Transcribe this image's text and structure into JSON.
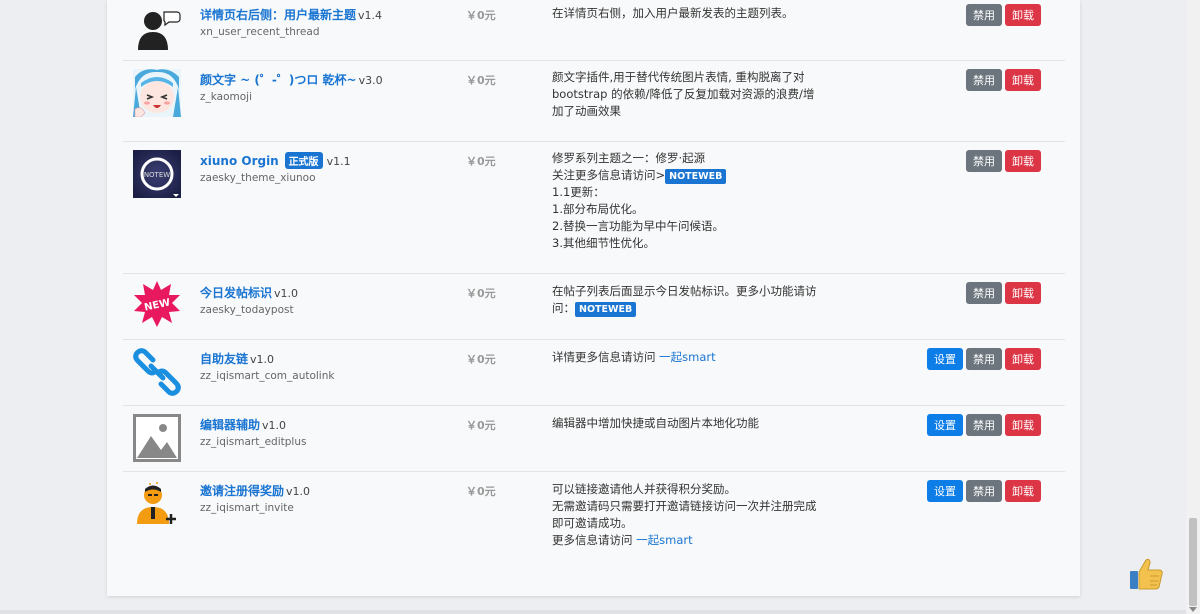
{
  "plugins": [
    {
      "name": "详情页右后侧：用户最新主题",
      "version": "v1.4",
      "id": "xn_user_recent_thread",
      "price": "￥0元",
      "desc": [
        "在详情页右侧，加入用户最新发表的主题列表。"
      ],
      "settings": false,
      "icon": "user-avatar-icon"
    },
    {
      "name": "颜文字 ~ (゜-゜)つロ 乾杯~",
      "version": "v3.0",
      "id": "z_kaomoji",
      "price": "￥0元",
      "desc": [
        "颜文字插件,用于替代传统图片表情, 重构脱离了对",
        "bootstrap 的依赖/降低了反复加载对资源的浪费/增",
        "加了动画效果"
      ],
      "settings": false,
      "icon": "anime-face-icon"
    },
    {
      "name": "xiuno Orgin",
      "badge": "正式版",
      "version": "v1.1",
      "id": "zaesky_theme_xiunoo",
      "price": "￥0元",
      "desc": [
        "修罗系列主题之一：修罗·起源",
        "关注更多信息请访问>",
        "1.1更新：",
        "1.部分布局优化。",
        "2.替换一言功能为早中午问候语。",
        "3.其他细节性优化。"
      ],
      "note": "NOTEWEB",
      "settings": false,
      "icon": "theme-ring-icon",
      "thumb_text": "NOTEW"
    },
    {
      "name": "今日发帖标识",
      "version": "v1.0",
      "id": "zaesky_todaypost",
      "price": "￥0元",
      "desc": [
        "在帖子列表后面显示今日发帖标识。更多小功能请访",
        "问："
      ],
      "note": "NOTEWEB",
      "settings": false,
      "icon": "new-star-icon",
      "thumb_text": "NEW"
    },
    {
      "name": "自助友链",
      "version": "v1.0",
      "id": "zz_iqismart_com_autolink",
      "price": "￥0元",
      "desc": [
        "详情更多信息请访问 "
      ],
      "link": "一起smart",
      "settings": true,
      "icon": "chain-link-icon"
    },
    {
      "name": "编辑器辅助",
      "version": "v1.0",
      "id": "zz_iqismart_editplus",
      "price": "￥0元",
      "desc": [
        "编辑器中增加快捷或自动图片本地化功能"
      ],
      "settings": true,
      "icon": "image-placeholder-icon"
    },
    {
      "name": "邀请注册得奖励",
      "version": "v1.0",
      "id": "zz_iqismart_invite",
      "price": "￥0元",
      "desc": [
        "可以链接邀请他人并获得积分奖励。",
        "无需邀请码只需要打开邀请链接访问一次并注册完成",
        "即可邀请成功。",
        "更多信息请访问 "
      ],
      "link": "一起smart",
      "settings": true,
      "icon": "user-add-icon"
    }
  ],
  "buttons": {
    "settings": "设置",
    "disable": "禁用",
    "uninstall": "卸载"
  }
}
